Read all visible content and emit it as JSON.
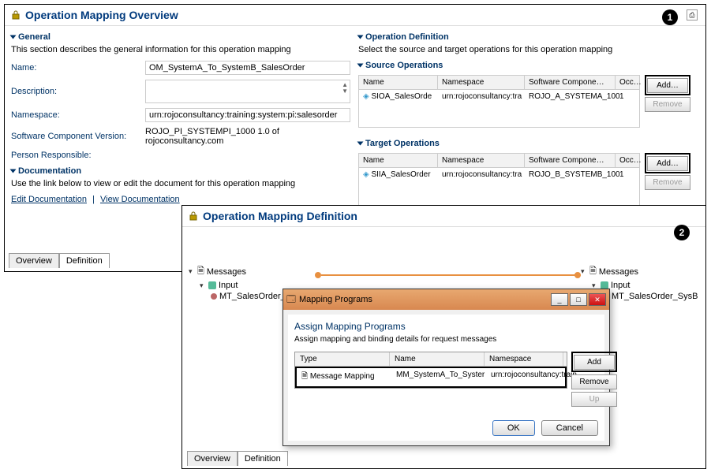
{
  "panel1": {
    "title": "Operation Mapping Overview",
    "general": {
      "heading": "General",
      "desc": "This section describes the general information for this operation mapping",
      "name_label": "Name:",
      "name_value": "OM_SystemA_To_SystemB_SalesOrder",
      "desc_label": "Description:",
      "ns_label": "Namespace:",
      "ns_value": "urn:rojoconsultancy:training:system:pi:salesorder",
      "swcv_label": "Software Component Version:",
      "swcv_value": "ROJO_PI_SYSTEMPI_1000 1.0 of rojoconsultancy.com",
      "resp_label": "Person Responsible:"
    },
    "doc": {
      "heading": "Documentation",
      "desc": "Use the link below to view or edit the document for this operation mapping",
      "edit": "Edit Documentation",
      "view": "View Documentation"
    },
    "opdef": {
      "heading": "Operation Definition",
      "desc": "Select the source and target operations for this operation mapping",
      "source_heading": "Source Operations",
      "target_heading": "Target Operations",
      "cols": {
        "name": "Name",
        "ns": "Namespace",
        "swc": "Software Compone…",
        "occ": "Occ…"
      },
      "source_row": {
        "name": "SIOA_SalesOrde",
        "ns": "urn:rojoconsultancy:tra",
        "swc": "ROJO_A_SYSTEMA_100",
        "occ": "1"
      },
      "target_row": {
        "name": "SIIA_SalesOrder",
        "ns": "urn:rojoconsultancy:tra",
        "swc": "ROJO_B_SYSTEMB_100",
        "occ": "1"
      },
      "add": "Add…",
      "remove": "Remove"
    },
    "tabs": {
      "overview": "Overview",
      "definition": "Definition"
    }
  },
  "panel2": {
    "title": "Operation Mapping Definition",
    "messages_label": "Messages",
    "input_label": "Input",
    "mt_left": "MT_SalesOrder_SysA",
    "mt_right": "MT_SalesOrder_SysB",
    "tabs": {
      "overview": "Overview",
      "definition": "Definition"
    }
  },
  "modal": {
    "title": "Mapping Programs",
    "heading": "Assign Mapping Programs",
    "sub": "Assign mapping and binding details for request messages",
    "cols": {
      "type": "Type",
      "name": "Name",
      "ns": "Namespace"
    },
    "row": {
      "type": "Message Mapping",
      "name": "MM_SystemA_To_Syster",
      "ns": "urn:rojoconsultancy:train"
    },
    "add": "Add",
    "remove": "Remove",
    "up": "Up",
    "ok": "OK",
    "cancel": "Cancel"
  },
  "badges": {
    "one": "1",
    "two": "2"
  }
}
